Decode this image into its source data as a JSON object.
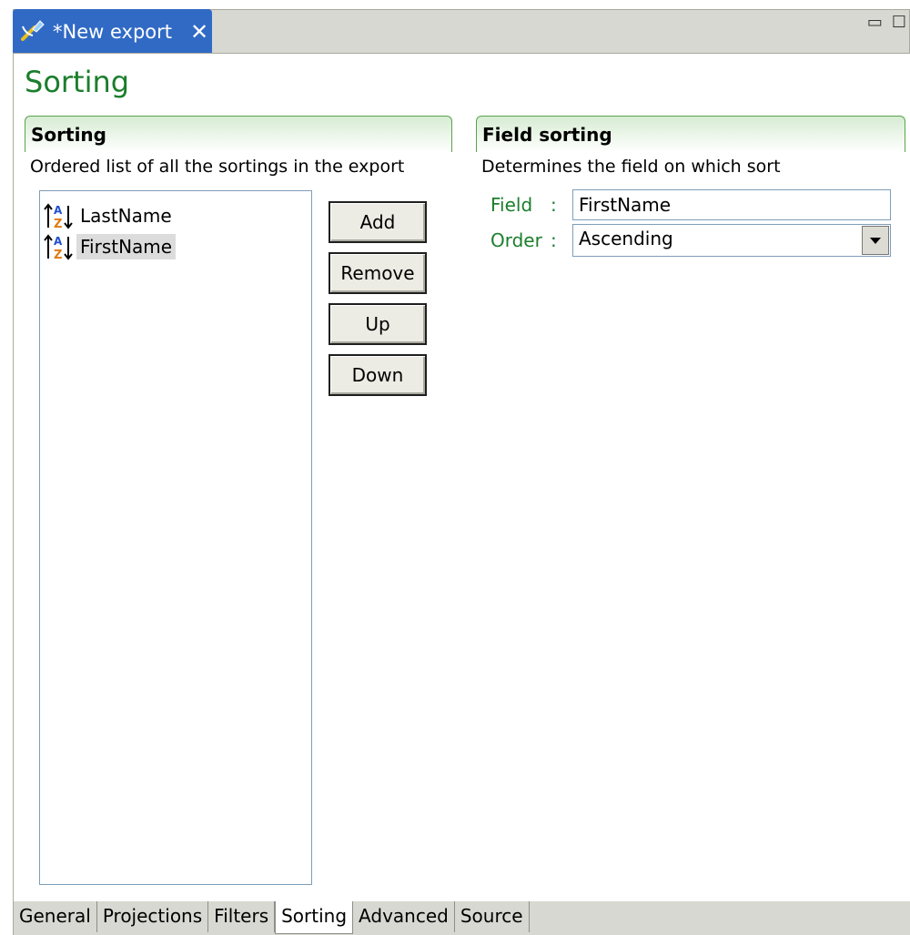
{
  "editor_tab": {
    "title": "*New export",
    "close_label": "✕",
    "icon": "export-wizard-icon"
  },
  "window_controls": {
    "minimize": "▭",
    "maximize": "☐"
  },
  "page_title": "Sorting",
  "sorting_section": {
    "title": "Sorting",
    "description": "Ordered list of all the sortings in the export",
    "items": [
      {
        "label": "LastName",
        "icon": "sort-ascending-az-icon",
        "selected": false
      },
      {
        "label": "FirstName",
        "icon": "sort-ascending-az-icon",
        "selected": true
      }
    ],
    "buttons": {
      "add": "Add",
      "remove": "Remove",
      "up": "Up",
      "down": "Down"
    }
  },
  "field_sorting_section": {
    "title": "Field sorting",
    "description": "Determines the field on which sort",
    "field_label": "Field",
    "field_value": "FirstName",
    "order_label": "Order",
    "order_value": "Ascending",
    "colon": ":"
  },
  "page_tabs": [
    {
      "label": "General",
      "active": false
    },
    {
      "label": "Projections",
      "active": false
    },
    {
      "label": "Filters",
      "active": false
    },
    {
      "label": "Sorting",
      "active": true
    },
    {
      "label": "Advanced",
      "active": false
    },
    {
      "label": "Source",
      "active": false
    }
  ],
  "colors": {
    "accent_green": "#1b7e2c",
    "tab_blue": "#316ac5",
    "section_border": "#5aa34e"
  }
}
